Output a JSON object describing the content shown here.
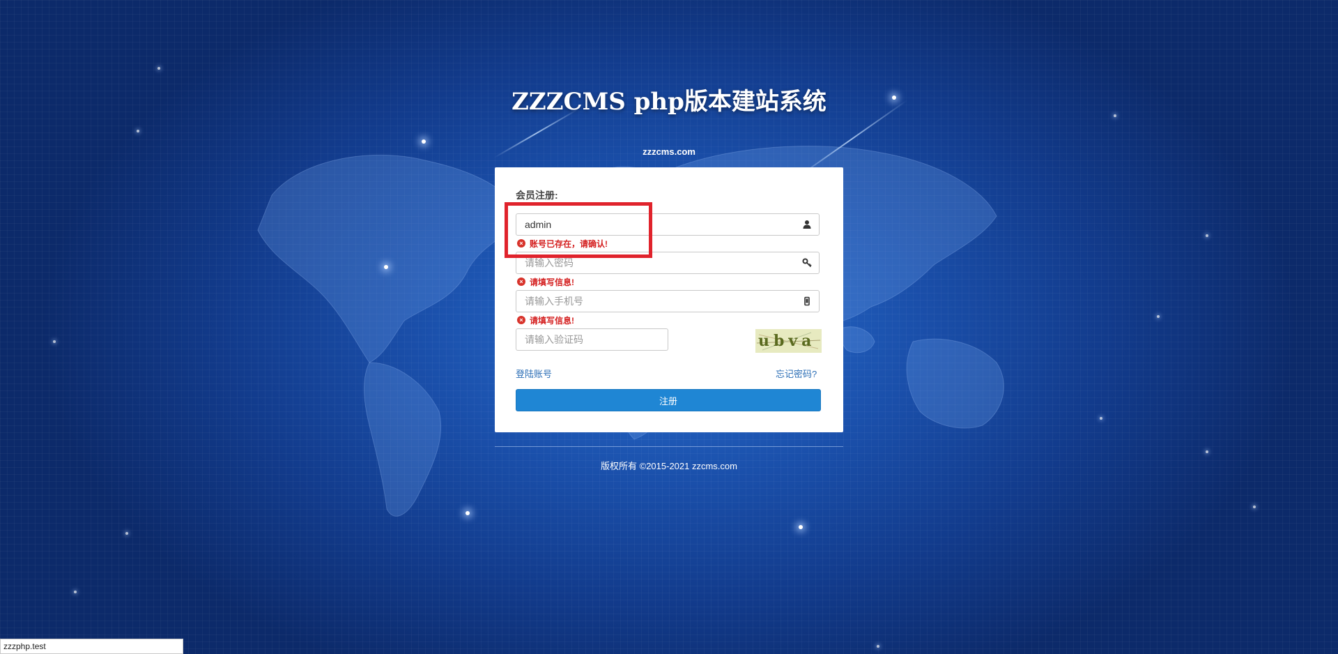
{
  "site": {
    "title": "ZZZCMS php版本建站系统",
    "domain": "zzzcms.com",
    "copyright": "版权所有 ©2015-2021 zzcms.com"
  },
  "form": {
    "heading": "会员注册:",
    "username": {
      "value": "admin",
      "icon": "user-icon",
      "error": "账号已存在，请确认!"
    },
    "password": {
      "value": "",
      "placeholder": "请输入密码",
      "icon": "key-icon",
      "error": "请填写信息!"
    },
    "phone": {
      "value": "",
      "placeholder": "请输入手机号",
      "icon": "mobile-icon",
      "error": "请填写信息!"
    },
    "captcha": {
      "value": "",
      "placeholder": "请输入验证码",
      "image_text": "ubva"
    },
    "login_link": "登陆账号",
    "forgot_link": "忘记密码?",
    "submit_label": "注册"
  },
  "browser": {
    "status_url": "zzzphp.test"
  },
  "colors": {
    "primary_button": "#1f86d4",
    "error_text": "#d41f1f",
    "highlight_box": "#e0232c",
    "link": "#2a6db5"
  }
}
